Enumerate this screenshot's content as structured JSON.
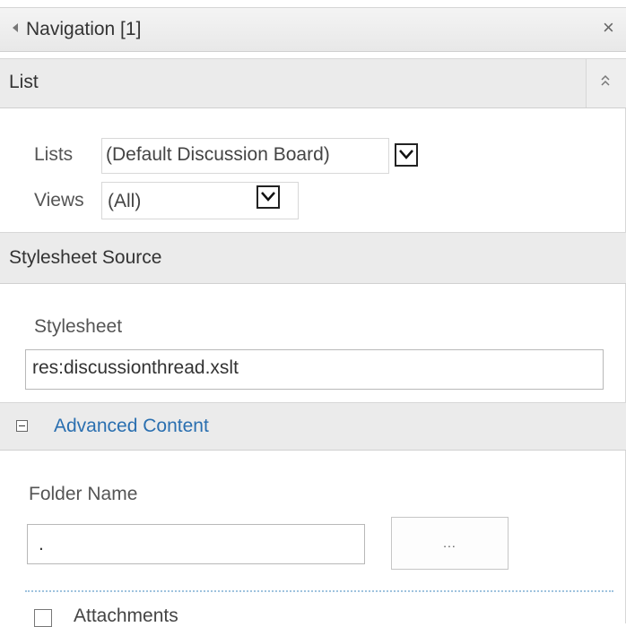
{
  "header": {
    "title": "Navigation [1]",
    "close_glyph": "×"
  },
  "list_section": {
    "label": "List",
    "lists_label": "Lists",
    "lists_value": "(Default Discussion Board)",
    "views_label": "Views",
    "views_value": "(All)"
  },
  "stylesheet_section": {
    "label": "Stylesheet Source",
    "stylesheet_label": "Stylesheet",
    "stylesheet_value": "res:discussionthread.xslt"
  },
  "advanced_section": {
    "label": "Advanced Content",
    "folder_name_label": "Folder Name",
    "folder_name_value": ".",
    "browse_label": "...",
    "attachments_label": "Attachments"
  },
  "colors": {
    "link_blue": "#2a6fb0",
    "bar_gray": "#ebebeb"
  },
  "icons": {
    "collapse": "left-triangle-icon",
    "close": "close-icon",
    "expander": "double-chevron-up-icon",
    "dropdown": "chevron-down-icon",
    "advanced_toggle": "minus-box-icon"
  }
}
